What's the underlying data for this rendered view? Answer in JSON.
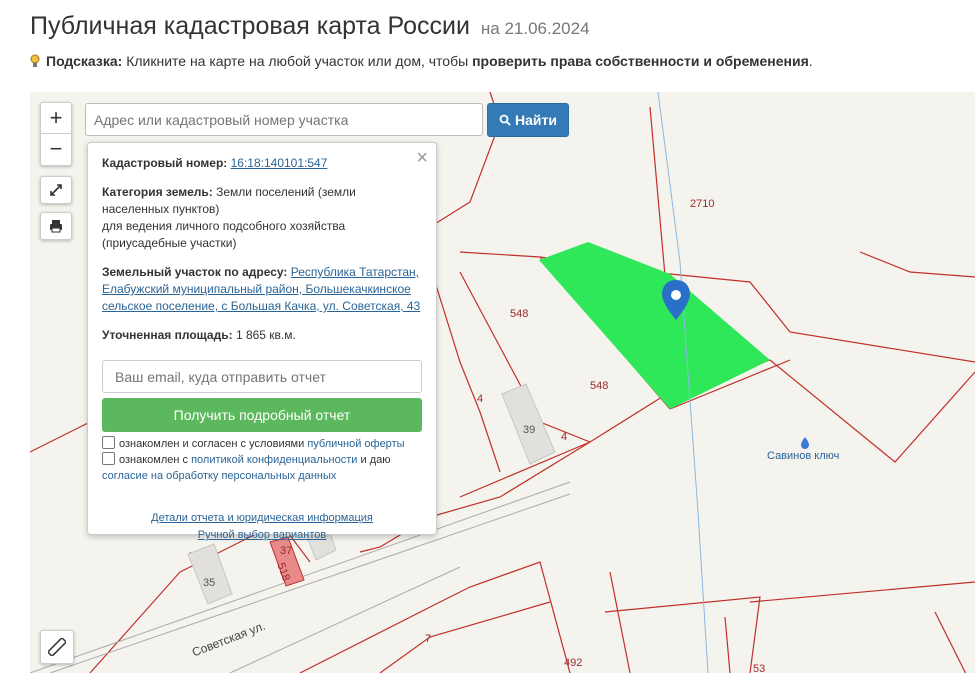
{
  "header": {
    "title": "Публичная кадастровая карта России",
    "date": "на 21.06.2024"
  },
  "hint": {
    "label": "Подсказка:",
    "text": "Кликните на карте на любой участок или дом, чтобы",
    "bold": "проверить права собственности и обременения",
    "end": "."
  },
  "controls": {
    "zoom_in": "+",
    "zoom_out": "−"
  },
  "search": {
    "placeholder": "Адрес или кадастровый номер участка",
    "button": "Найти"
  },
  "popup": {
    "cad_label": "Кадастровый номер:",
    "cad_value": "16:18:140101:547",
    "cat_label": "Категория земель:",
    "cat_value": "Земли поселений (земли населенных пунктов)",
    "use_value": "для ведения личного подсобного хозяйства (приусадебные участки)",
    "addr_label": "Земельный участок по адресу:",
    "addr_value": "Республика Татарстан, Елабужский муниципальный район, Большекачкинское сельское поселение, с Большая Качка, ул. Советская, 43",
    "area_label": "Уточненная площадь:",
    "area_value": "1 865 кв.м.",
    "email_placeholder": "Ваш email, куда отправить отчет",
    "report_button": "Получить подробный отчет",
    "check1_text": "ознакомлен и согласен с условиями",
    "check1_link": "публичной оферты",
    "check2_text": "ознакомлен с",
    "check2_link": "политикой конфиденциальности",
    "check2_mid": "и даю",
    "check2_link2": "согласие на обработку персональных данных",
    "link_details": "Детали отчета и юридическая информация",
    "link_manual": "Ручной выбор вариантов"
  },
  "map": {
    "labels": [
      "2710",
      "548",
      "548",
      "4",
      "4",
      "39",
      "35",
      "37",
      "518",
      "7",
      "492",
      "53"
    ],
    "street": "Советская ул.",
    "place": "Савинов ключ",
    "selected_color": "#2ee85a"
  }
}
